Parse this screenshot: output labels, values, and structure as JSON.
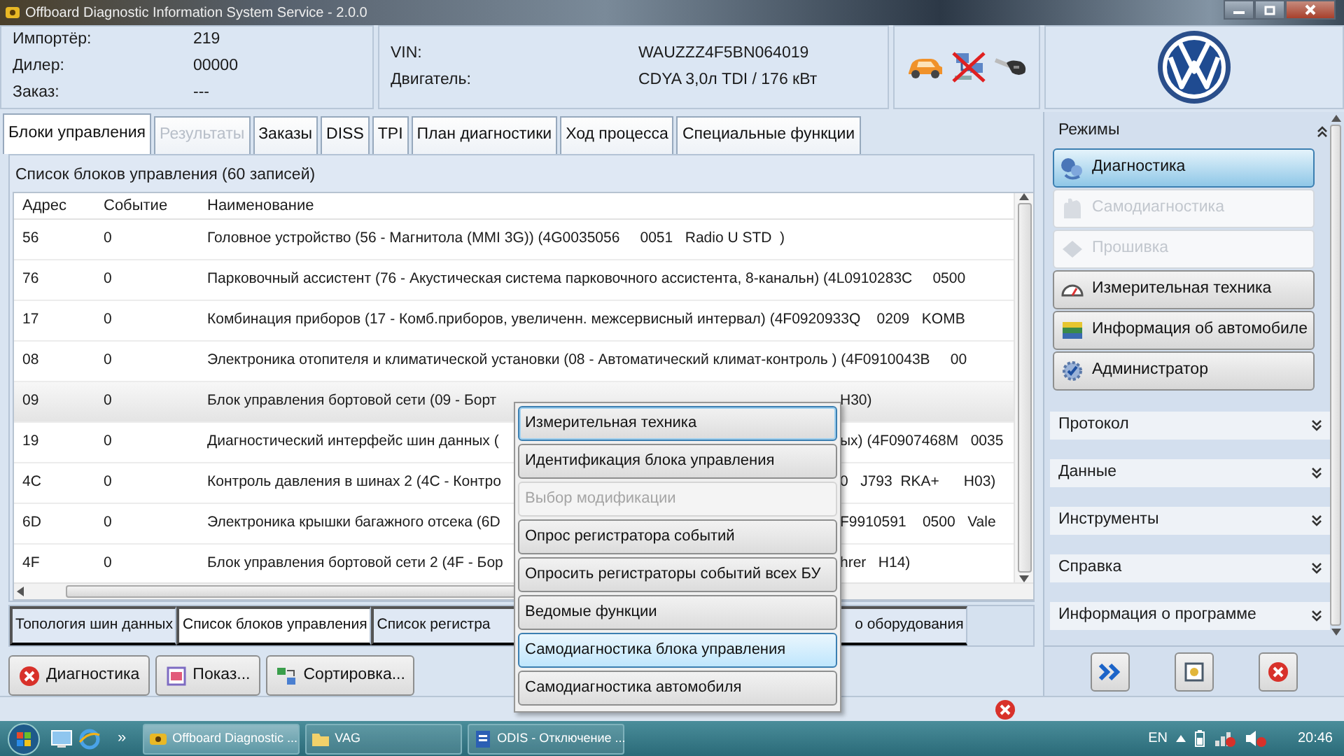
{
  "window": {
    "title": "Offboard Diagnostic Information System Service - 2.0.0"
  },
  "header": {
    "order_info": [
      {
        "label": "Импортёр:",
        "value": "219"
      },
      {
        "label": "Дилер:",
        "value": "00000"
      },
      {
        "label": "Заказ:",
        "value": "---"
      }
    ],
    "vehicle_info": [
      {
        "label": "VIN:",
        "value": "WAUZZZ4F5BN064019"
      },
      {
        "label": "Двигатель:",
        "value": "CDYA 3,0л TDI / 176 кВт"
      }
    ],
    "connected": false
  },
  "tabs": [
    {
      "label": "Блоки управления",
      "selected": true,
      "disabled": false
    },
    {
      "label": "Результаты",
      "selected": false,
      "disabled": true
    },
    {
      "label": "Заказы",
      "selected": false,
      "disabled": false
    },
    {
      "label": "DISS",
      "selected": false,
      "disabled": false
    },
    {
      "label": "TPI",
      "selected": false,
      "disabled": false
    },
    {
      "label": "План диагностики",
      "selected": false,
      "disabled": false
    },
    {
      "label": "Ход процесса",
      "selected": false,
      "disabled": false
    },
    {
      "label": "Специальные функции",
      "selected": false,
      "disabled": false
    }
  ],
  "control_units": {
    "title": "Список блоков управления (60 записей)",
    "columns": [
      "Адрес",
      "Событие",
      "Наименование"
    ],
    "rows": [
      {
        "address": "56",
        "event": "0",
        "name": "Головное устройство (56 - Магнитола (MMI 3G)) (4G0035056     0051   Radio U STD  )",
        "selected": false
      },
      {
        "address": "76",
        "event": "0",
        "name": "Парковочный ассистент (76 - Акустическая система парковочного ассистента, 8-канальн) (4L0910283C     0500",
        "selected": false
      },
      {
        "address": "17",
        "event": "0",
        "name": "Комбинация приборов (17 - Комб.приборов, увеличенн. межсервисный интервал) (4F0920933Q    0209   KOMB",
        "selected": false
      },
      {
        "address": "08",
        "event": "0",
        "name": "Электроника отопителя и климатической установки (08 - Автоматический климат-контроль ) (4F0910043B     00",
        "selected": false
      },
      {
        "address": "09",
        "event": "0",
        "name": "Блок управления бортовой сети (09 - Борт",
        "name_tail": "H30)",
        "selected": true
      },
      {
        "address": "19",
        "event": "0",
        "name": "Диагностический интерфейс шин данных (",
        "name_tail": "ых) (4F0907468M   0035",
        "selected": false
      },
      {
        "address": "4C",
        "event": "0",
        "name": "Контроль давления в шинах 2 (4C - Контро",
        "name_tail": "0   J793  RKA+      H03)",
        "selected": false
      },
      {
        "address": "6D",
        "event": "0",
        "name": "Электроника крышки багажного отсека (6D",
        "name_tail": "F9910591    0500   Vale",
        "selected": false
      },
      {
        "address": "4F",
        "event": "0",
        "name": "Блок управления бортовой сети 2 (4F - Бор",
        "name_tail": "hrer   H14)",
        "selected": false
      }
    ]
  },
  "view_tabs": [
    {
      "label": "Топология шин данных",
      "selected": false
    },
    {
      "label": "Список блоков управления",
      "selected": true
    },
    {
      "label": "Список регистра",
      "selected": false
    },
    {
      "label": "о оборудования",
      "selected": false
    }
  ],
  "actions": [
    "Диагностика",
    "Показ...",
    "Сортировка..."
  ],
  "context_menu": {
    "items": [
      {
        "label": "Измерительная техника",
        "focused": true,
        "selected": false,
        "disabled": false
      },
      {
        "label": "Идентификация блока управления",
        "focused": false,
        "selected": false,
        "disabled": false
      },
      {
        "label": "Выбор модификации",
        "focused": false,
        "selected": false,
        "disabled": true
      },
      {
        "label": "Опрос регистратора событий",
        "focused": false,
        "selected": false,
        "disabled": false
      },
      {
        "label": "Опросить регистраторы событий всех БУ",
        "focused": false,
        "selected": false,
        "disabled": false
      },
      {
        "label": "Ведомые функции",
        "focused": false,
        "selected": false,
        "disabled": false
      },
      {
        "label": "Самодиагностика блока управления",
        "focused": false,
        "selected": true,
        "disabled": false
      },
      {
        "label": "Самодиагностика автомобиля",
        "focused": false,
        "selected": false,
        "disabled": false
      }
    ]
  },
  "sidebar": {
    "title": "Режимы",
    "expanded": true,
    "modes": [
      {
        "label": "Диагностика",
        "selected": true,
        "disabled": false
      },
      {
        "label": "Самодиагностика",
        "selected": false,
        "disabled": true
      },
      {
        "label": "Прошивка",
        "selected": false,
        "disabled": true
      },
      {
        "label": "Измерительная техника",
        "selected": false,
        "disabled": false
      },
      {
        "label": "Информация об автомобиле",
        "selected": false,
        "disabled": false
      },
      {
        "label": "Администратор",
        "selected": false,
        "disabled": false
      }
    ],
    "sections": [
      {
        "label": "Протокол",
        "expanded": false
      },
      {
        "label": "Данные",
        "expanded": false
      },
      {
        "label": "Инструменты",
        "expanded": false
      },
      {
        "label": "Справка",
        "expanded": false
      },
      {
        "label": "Информация о программе",
        "expanded": false
      }
    ]
  },
  "taskbar": {
    "overflow": "»",
    "tasks": [
      {
        "label": "Offboard Diagnostic ...",
        "selected": true
      },
      {
        "label": "VAG",
        "selected": false
      },
      {
        "label": "ODIS - Отключение ...",
        "selected": false
      }
    ],
    "language": "EN",
    "clock": "20:46"
  }
}
